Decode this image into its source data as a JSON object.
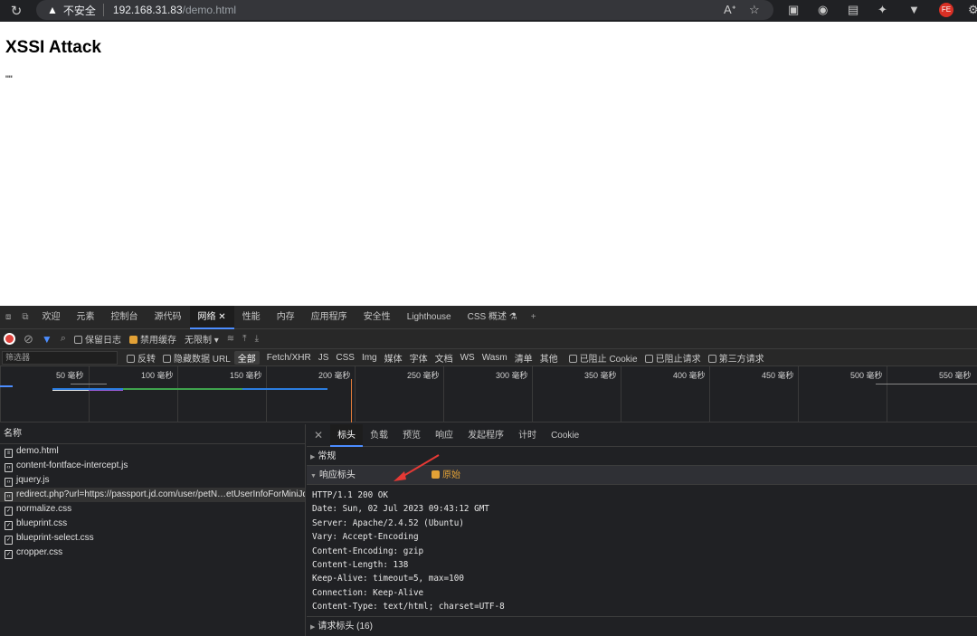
{
  "browser": {
    "security_label": "不安全",
    "url_host": "192.168.31.83",
    "url_path": "/demo.html"
  },
  "page": {
    "title": "XSSI Attack",
    "output": "\"\""
  },
  "devtools": {
    "tabs": [
      "欢迎",
      "元素",
      "控制台",
      "源代码",
      "网络",
      "性能",
      "内存",
      "应用程序",
      "安全性",
      "Lighthouse",
      "CSS 概述"
    ],
    "active_tab": "网络",
    "toolbar": {
      "preserve_log": "保留日志",
      "disable_cache": "禁用缓存",
      "throttle": "无限制"
    },
    "filter": {
      "placeholder": "筛选器",
      "invert": "反转",
      "hide_data_urls": "隐藏数据 URL",
      "types": [
        "全部",
        "Fetch/XHR",
        "JS",
        "CSS",
        "Img",
        "媒体",
        "字体",
        "文档",
        "WS",
        "Wasm",
        "清单",
        "其他"
      ],
      "blocked_cookies": "已阻止 Cookie",
      "blocked_requests": "已阻止请求",
      "third_party": "第三方请求"
    },
    "timeline_ticks": [
      "50 毫秒",
      "100 毫秒",
      "150 毫秒",
      "200 毫秒",
      "250 毫秒",
      "300 毫秒",
      "350 毫秒",
      "400 毫秒",
      "450 毫秒",
      "500 毫秒",
      "550 毫秒"
    ],
    "name_header": "名称",
    "requests": [
      "demo.html",
      "content-fontface-intercept.js",
      "jquery.js",
      "redirect.php?url=https://passport.jd.com/user/petN…etUserInfoForMiniJd…",
      "normalize.css",
      "blueprint.css",
      "blueprint-select.css",
      "cropper.css"
    ],
    "detail_tabs": [
      "标头",
      "负载",
      "预览",
      "响应",
      "发起程序",
      "计时",
      "Cookie"
    ],
    "sections": {
      "general": "常规",
      "response_headers": "响应标头",
      "raw_label": "原始",
      "request_headers": "请求标头 (16)"
    },
    "response_raw": [
      "HTTP/1.1 200 OK",
      "Date: Sun, 02 Jul 2023 09:43:12 GMT",
      "Server: Apache/2.4.52 (Ubuntu)",
      "Vary: Accept-Encoding",
      "Content-Encoding: gzip",
      "Content-Length: 138",
      "Keep-Alive: timeout=5, max=100",
      "Connection: Keep-Alive",
      "Content-Type: text/html; charset=UTF-8"
    ]
  }
}
